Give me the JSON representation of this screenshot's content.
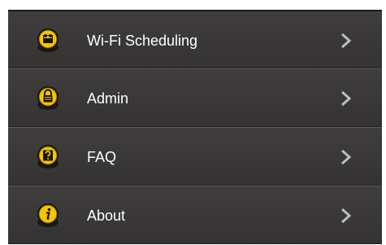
{
  "menu": {
    "items": [
      {
        "label": "Wi-Fi Scheduling",
        "icon": "scheduler-icon"
      },
      {
        "label": "Admin",
        "icon": "lock-icon"
      },
      {
        "label": "FAQ",
        "icon": "question-icon"
      },
      {
        "label": "About",
        "icon": "info-icon"
      }
    ]
  },
  "colors": {
    "background": "#3b3938",
    "icon_yellow": "#f5c400",
    "text": "#ffffff",
    "chevron": "#bdbdbd"
  }
}
